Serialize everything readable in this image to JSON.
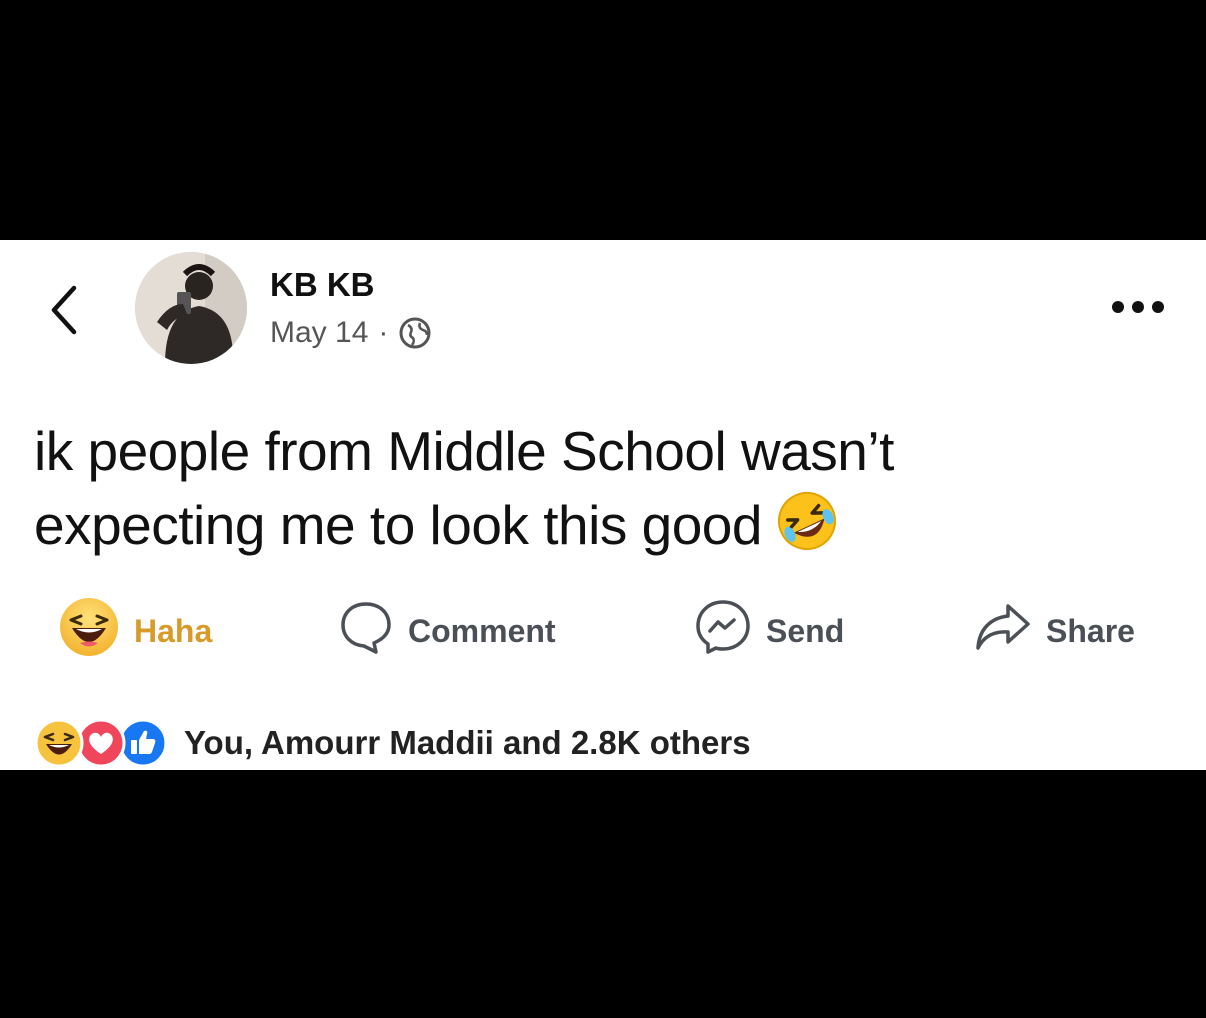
{
  "header": {
    "author_name": "KB KB",
    "post_date": "May 14",
    "separator": "·",
    "privacy_icon": "globe-icon",
    "back_icon": "chevron-left-icon",
    "more_icon": "more-horizontal-icon"
  },
  "post": {
    "text_line_1": "ik people from Middle School wasn’t",
    "text_line_2": "expecting me to look this good",
    "emoji": "rolling-on-floor-laughing-emoji"
  },
  "actions": {
    "reaction_label": "Haha",
    "comment_label": "Comment",
    "send_label": "Send",
    "share_label": "Share"
  },
  "reactions_summary": {
    "icons": [
      "haha-reaction-icon",
      "love-reaction-icon",
      "like-reaction-icon"
    ],
    "text": "You, Amourr Maddii and 2.8K others"
  },
  "colors": {
    "haha_accent": "#d89b2a",
    "love": "#f0465b",
    "like": "#1877f2",
    "text_primary": "#111111",
    "text_secondary": "#555555",
    "action_text": "#4b4f56"
  }
}
